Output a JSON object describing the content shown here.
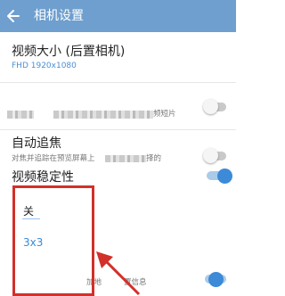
{
  "header": {
    "title": "相机设置"
  },
  "video_size": {
    "title": "视频大小 (后置相机)",
    "value": "FHD 1920x1080"
  },
  "short_video": {
    "fragment": "频短片",
    "on": false
  },
  "auto_focus": {
    "title": "自动追焦",
    "desc_part1": "对焦并追踪在预览屏幕上",
    "desc_part2": "择的",
    "on": false
  },
  "stabilization": {
    "title": "视频稳定性",
    "on": true
  },
  "grid_menu": {
    "options": [
      {
        "label": "关",
        "selected": false
      },
      {
        "label": "3x3",
        "selected": true
      }
    ]
  },
  "location_tag": {
    "fragment": "加地",
    "fragment2": "置信息",
    "on": true
  },
  "colors": {
    "accent": "#3c8ad8",
    "header": "#6f9fce",
    "highlight": "#d2302a"
  }
}
